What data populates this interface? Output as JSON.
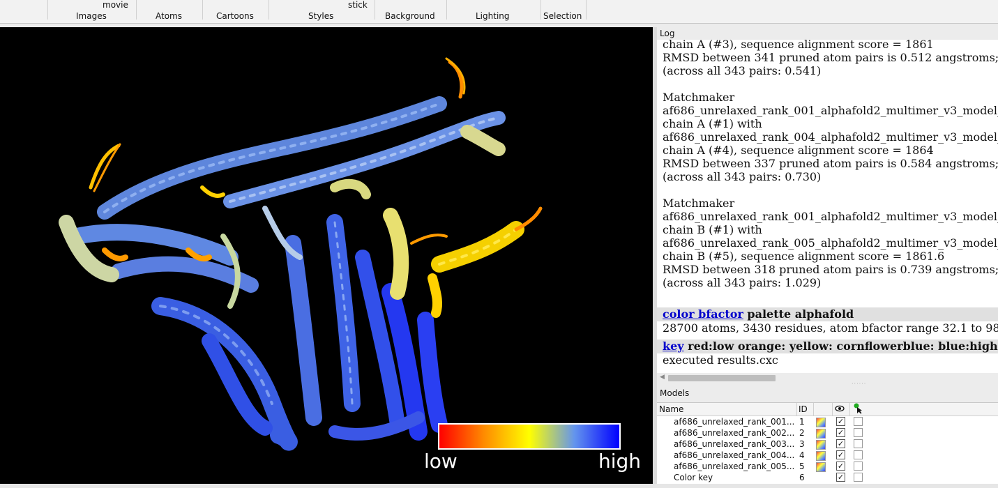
{
  "toolbar": {
    "groups": [
      {
        "label": "Images",
        "sub": "movie"
      },
      {
        "label": "Atoms"
      },
      {
        "label": "Cartoons"
      },
      {
        "label": "Styles",
        "sub": "stick"
      },
      {
        "label": "Background"
      },
      {
        "label": "Lighting"
      },
      {
        "label": "Selection"
      }
    ]
  },
  "viewport": {
    "color_key": {
      "low_label": "low",
      "high_label": "high",
      "colors": [
        "#ff0000",
        "#ff8c00",
        "#ffff00",
        "#6495ed",
        "#0000ff"
      ]
    }
  },
  "log": {
    "title": "Log",
    "lines": [
      "chain A (#3), sequence alignment score = 1861",
      "RMSD between 341 pruned atom pairs is 0.512 angstroms;",
      "(across all 343 pairs: 0.541)",
      "Matchmaker",
      "af686_unrelaxed_rank_001_alphafold2_multimer_v3_model_",
      "chain A (#1) with",
      "af686_unrelaxed_rank_004_alphafold2_multimer_v3_model_",
      "chain A (#4), sequence alignment score = 1864",
      "RMSD between 337 pruned atom pairs is 0.584 angstroms;",
      "(across all 343 pairs: 0.730)",
      "Matchmaker",
      "af686_unrelaxed_rank_001_alphafold2_multimer_v3_model_",
      "chain B (#1) with",
      "af686_unrelaxed_rank_005_alphafold2_multimer_v3_model_",
      "chain B (#5), sequence alignment score = 1861.6",
      "RMSD between 318 pruned atom pairs is 0.739 angstroms;",
      "(across all 343 pairs: 1.029)"
    ],
    "cmd1_link": "color bfactor",
    "cmd1_rest": " palette alphafold",
    "cmd1_result": "28700 atoms, 3430 residues, atom bfactor range 32.1 to 98",
    "cmd2_link": "key",
    "cmd2_rest": " red:low orange: yellow: cornflowerblue: blue:high",
    "cmd2_result": "executed results.cxc"
  },
  "models": {
    "title": "Models",
    "columns": {
      "name": "Name",
      "id": "ID"
    },
    "rows": [
      {
        "name": "af686_unrelaxed_rank_001...",
        "id": "1",
        "swatch": true,
        "shown": true
      },
      {
        "name": "af686_unrelaxed_rank_002...",
        "id": "2",
        "swatch": true,
        "shown": true
      },
      {
        "name": "af686_unrelaxed_rank_003...",
        "id": "3",
        "swatch": true,
        "shown": true
      },
      {
        "name": "af686_unrelaxed_rank_004...",
        "id": "4",
        "swatch": true,
        "shown": true
      },
      {
        "name": "af686_unrelaxed_rank_005...",
        "id": "5",
        "swatch": true,
        "shown": true
      },
      {
        "name": "Color key",
        "id": "6",
        "swatch": false,
        "shown": true
      }
    ]
  }
}
